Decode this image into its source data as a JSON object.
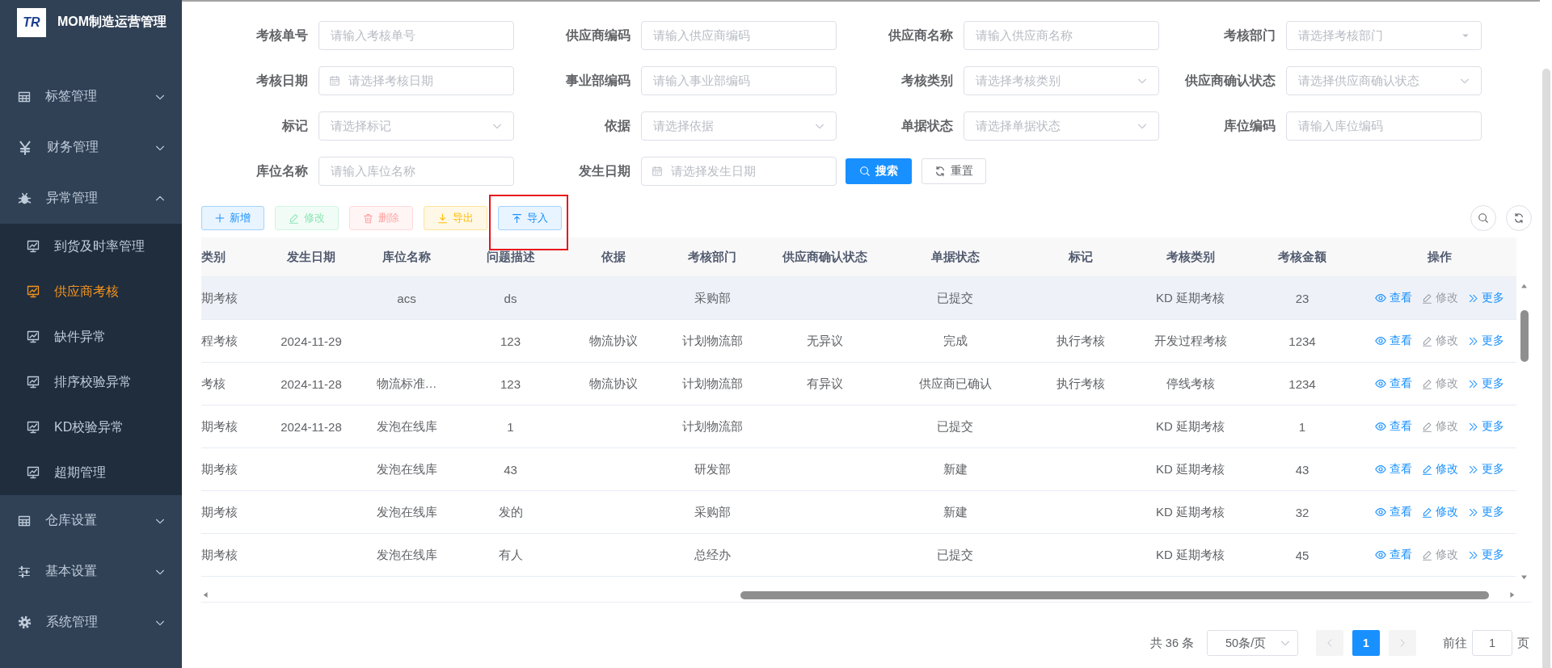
{
  "app": {
    "logo_text": "TR",
    "title": "MOM制造运营管理"
  },
  "sidebar": {
    "items": [
      {
        "label": "标签管理",
        "expanded": false
      },
      {
        "label": "财务管理",
        "expanded": false
      },
      {
        "label": "异常管理",
        "expanded": true,
        "children": [
          {
            "label": "到货及时率管理",
            "selected": false
          },
          {
            "label": "供应商考核",
            "selected": true
          },
          {
            "label": "缺件异常",
            "selected": false
          },
          {
            "label": "排序校验异常",
            "selected": false
          },
          {
            "label": "KD校验异常",
            "selected": false
          },
          {
            "label": "超期管理",
            "selected": false
          }
        ]
      },
      {
        "label": "仓库设置",
        "expanded": false
      },
      {
        "label": "基本设置",
        "expanded": false
      },
      {
        "label": "系统管理",
        "expanded": false
      }
    ]
  },
  "filters": {
    "fields": [
      {
        "label": "考核单号",
        "kind": "text",
        "placeholder": "请输入考核单号"
      },
      {
        "label": "供应商编码",
        "kind": "text",
        "placeholder": "请输入供应商编码"
      },
      {
        "label": "供应商名称",
        "kind": "text",
        "placeholder": "请输入供应商名称"
      },
      {
        "label": "考核部门",
        "kind": "tree",
        "placeholder": "请选择考核部门"
      },
      {
        "label": "考核日期",
        "kind": "date",
        "placeholder": "请选择考核日期"
      },
      {
        "label": "事业部编码",
        "kind": "text",
        "placeholder": "请输入事业部编码"
      },
      {
        "label": "考核类别",
        "kind": "select",
        "placeholder": "请选择考核类别"
      },
      {
        "label": "供应商确认状态",
        "kind": "select",
        "placeholder": "请选择供应商确认状态"
      },
      {
        "label": "标记",
        "kind": "select",
        "placeholder": "请选择标记"
      },
      {
        "label": "依据",
        "kind": "select",
        "placeholder": "请选择依据"
      },
      {
        "label": "单据状态",
        "kind": "select",
        "placeholder": "请选择单据状态"
      },
      {
        "label": "库位编码",
        "kind": "text",
        "placeholder": "请输入库位编码"
      },
      {
        "label": "库位名称",
        "kind": "text",
        "placeholder": "请输入库位名称"
      },
      {
        "label": "发生日期",
        "kind": "date",
        "placeholder": "请选择发生日期"
      }
    ],
    "search_button": "搜索",
    "reset_button": "重置"
  },
  "toolbar": {
    "buttons": [
      {
        "label": "新增",
        "kind": "add",
        "disabled": false,
        "annotated": false
      },
      {
        "label": "修改",
        "kind": "edit",
        "disabled": true,
        "annotated": false
      },
      {
        "label": "删除",
        "kind": "delete",
        "disabled": true,
        "annotated": false
      },
      {
        "label": "导出",
        "kind": "export",
        "disabled": false,
        "annotated": false
      },
      {
        "label": "导入",
        "kind": "import",
        "disabled": false,
        "annotated": true
      }
    ]
  },
  "table": {
    "columns": [
      "类别",
      "发生日期",
      "库位名称",
      "问题描述",
      "依据",
      "考核部门",
      "供应商确认状态",
      "单据状态",
      "标记",
      "考核类别",
      "考核金额",
      "操作"
    ],
    "rows": [
      {
        "highlighted": true,
        "cells": [
          "期考核",
          null,
          "acs",
          "ds",
          null,
          "采购部",
          null,
          "已提交",
          null,
          "KD 延期考核",
          "23"
        ],
        "actions": [
          {
            "label": "查看",
            "kind": "view",
            "disabled": false
          },
          {
            "label": "修改",
            "kind": "edit",
            "disabled": true
          },
          {
            "label": "更多",
            "kind": "more",
            "disabled": false
          }
        ]
      },
      {
        "highlighted": false,
        "cells": [
          "程考核",
          "2024-11-29",
          null,
          "123",
          "物流协议",
          "计划物流部",
          "无异议",
          "完成",
          "执行考核",
          "开发过程考核",
          "1234"
        ],
        "actions": [
          {
            "label": "查看",
            "kind": "view",
            "disabled": false
          },
          {
            "label": "修改",
            "kind": "edit",
            "disabled": true
          },
          {
            "label": "更多",
            "kind": "more",
            "disabled": false
          }
        ]
      },
      {
        "highlighted": false,
        "cells": [
          "考核",
          "2024-11-28",
          "物流标准…",
          "123",
          "物流协议",
          "计划物流部",
          "有异议",
          "供应商已确认",
          "执行考核",
          "停线考核",
          "1234"
        ],
        "actions": [
          {
            "label": "查看",
            "kind": "view",
            "disabled": false
          },
          {
            "label": "修改",
            "kind": "edit",
            "disabled": true
          },
          {
            "label": "更多",
            "kind": "more",
            "disabled": false
          }
        ]
      },
      {
        "highlighted": false,
        "cells": [
          "期考核",
          "2024-11-28",
          "发泡在线库",
          "1",
          null,
          "计划物流部",
          null,
          "已提交",
          null,
          "KD 延期考核",
          "1"
        ],
        "actions": [
          {
            "label": "查看",
            "kind": "view",
            "disabled": false
          },
          {
            "label": "修改",
            "kind": "edit",
            "disabled": true
          },
          {
            "label": "更多",
            "kind": "more",
            "disabled": false
          }
        ]
      },
      {
        "highlighted": false,
        "cells": [
          "期考核",
          null,
          "发泡在线库",
          "43",
          null,
          "研发部",
          null,
          "新建",
          null,
          "KD 延期考核",
          "43"
        ],
        "actions": [
          {
            "label": "查看",
            "kind": "view",
            "disabled": false
          },
          {
            "label": "修改",
            "kind": "edit",
            "disabled": false
          },
          {
            "label": "更多",
            "kind": "more",
            "disabled": false
          }
        ]
      },
      {
        "highlighted": false,
        "cells": [
          "期考核",
          null,
          "发泡在线库",
          "发的",
          null,
          "采购部",
          null,
          "新建",
          null,
          "KD 延期考核",
          "32"
        ],
        "actions": [
          {
            "label": "查看",
            "kind": "view",
            "disabled": false
          },
          {
            "label": "修改",
            "kind": "edit",
            "disabled": false
          },
          {
            "label": "更多",
            "kind": "more",
            "disabled": false
          }
        ]
      },
      {
        "highlighted": false,
        "cells": [
          "期考核",
          null,
          "发泡在线库",
          "有人",
          null,
          "总经办",
          null,
          "已提交",
          null,
          "KD 延期考核",
          "45"
        ],
        "actions": [
          {
            "label": "查看",
            "kind": "view",
            "disabled": false
          },
          {
            "label": "修改",
            "kind": "edit",
            "disabled": true
          },
          {
            "label": "更多",
            "kind": "more",
            "disabled": false
          }
        ]
      }
    ]
  },
  "pagination": {
    "total": "共 36 条",
    "page_size": "50条/页",
    "pages": [
      {
        "label": "1",
        "selected": true
      }
    ],
    "goto_label": "前往",
    "goto_value": "1",
    "goto_suffix": "页"
  }
}
